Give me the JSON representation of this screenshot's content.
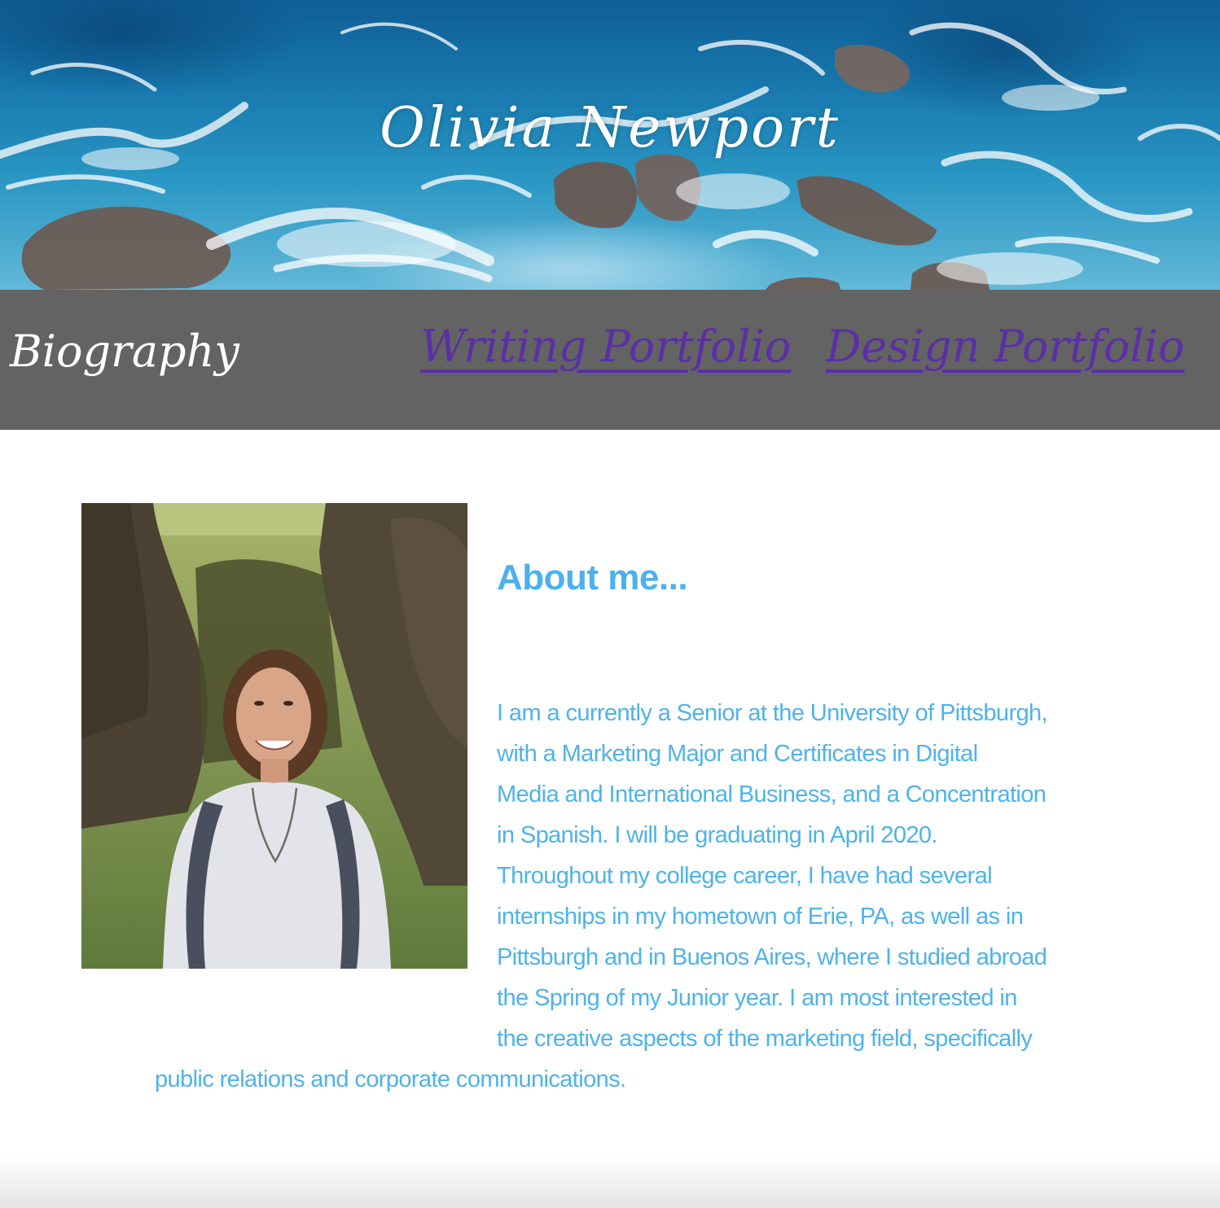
{
  "site": {
    "title": "Olivia Newport"
  },
  "nav": {
    "items": [
      {
        "label": "Biography",
        "active": true
      },
      {
        "label": "Writing Portfolio",
        "active": false
      },
      {
        "label": "Design Portfolio",
        "active": false
      }
    ]
  },
  "about": {
    "heading": "About me...",
    "lines": [
      "I am a currently a Senior at the University of Pittsburgh,",
      "with a Marketing Major and Certificates in Digital",
      "Media and International Business, and a Concentration",
      "in Spanish. I will be graduating in April 2020.",
      "Throughout my college career, I have had several",
      "internships in my hometown of Erie, PA, as well as in",
      "Pittsburgh and in Buenos Aires, where I studied abroad",
      "the Spring of my Junior year. I am most interested in",
      "the creative aspects of the marketing field, specifically",
      "public relations and corporate communications."
    ]
  },
  "colors": {
    "nav_background": "#636363",
    "link": "#5b2fa5",
    "accent_text": "#4eb2ec",
    "heading_text": "#4cb0ee"
  }
}
